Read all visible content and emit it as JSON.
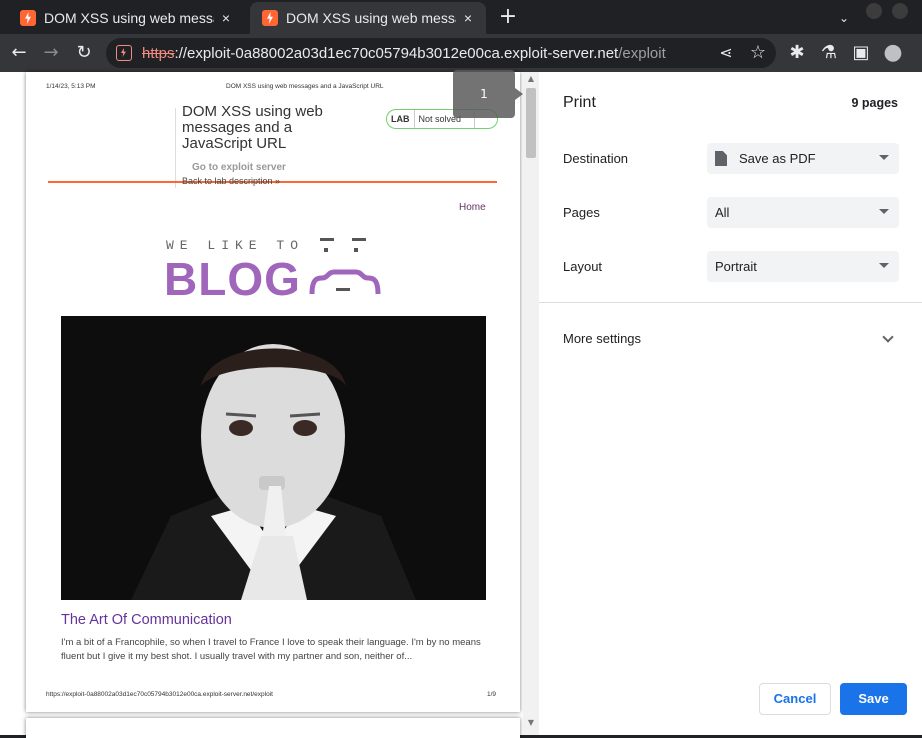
{
  "tabs": [
    {
      "title": "DOM XSS using web messages and a JavaScript URL",
      "close": "×"
    },
    {
      "title": "DOM XSS using web messages and a JavaScript URL",
      "close": "×"
    }
  ],
  "new_tab": "+",
  "tab_list": "⌄",
  "toolbar": {
    "back": "←",
    "forward": "→",
    "reload": "↻",
    "url_scheme": "https",
    "url_sep": "://",
    "url_host": "exploit-0a88002a03d1ec70c05794b3012e00ca.exploit-server.net",
    "url_path": "/exploit",
    "share": "⋖",
    "star": "☆",
    "extensions": "✱",
    "labs": "⚗",
    "sidepanel": "▣",
    "profile": "●"
  },
  "preview": {
    "page_tooltip": "1",
    "header_date": "1/14/23, 5:13 PM",
    "header_title": "DOM XSS using web messages and a JavaScript URL",
    "lab_title": "DOM XSS using web messages and a JavaScript URL",
    "lab_label": "LAB",
    "lab_status": "Not solved",
    "go_to_exploit": "Go to exploit server",
    "back_to_lab": "Back to lab description »",
    "nav_home": "Home",
    "logo_top": "WE LIKE TO",
    "logo_main": "BLOG",
    "post_title": "The Art Of Communication",
    "post_text": "I'm a bit of a Francophile, so when I travel to France I love to speak their language. I'm by no means fluent but I give it my best shot. I usually travel with my partner and son, neither of...",
    "footer_url": "https://exploit-0a88002a03d1ec70c05794b3012e00ca.exploit-server.net/exploit",
    "footer_page": "1/9",
    "scroll_up": "▲",
    "scroll_down": "▼"
  },
  "print": {
    "title": "Print",
    "page_count": "9 pages",
    "destination_label": "Destination",
    "destination_value": "Save as PDF",
    "pages_label": "Pages",
    "pages_value": "All",
    "layout_label": "Layout",
    "layout_value": "Portrait",
    "more_settings": "More settings",
    "cancel": "Cancel",
    "save": "Save"
  },
  "colors": {
    "accent_blue": "#1a73e8",
    "lab_orange": "#ff6633",
    "blog_purple": "#a066bb",
    "status_green": "#70d16d"
  }
}
